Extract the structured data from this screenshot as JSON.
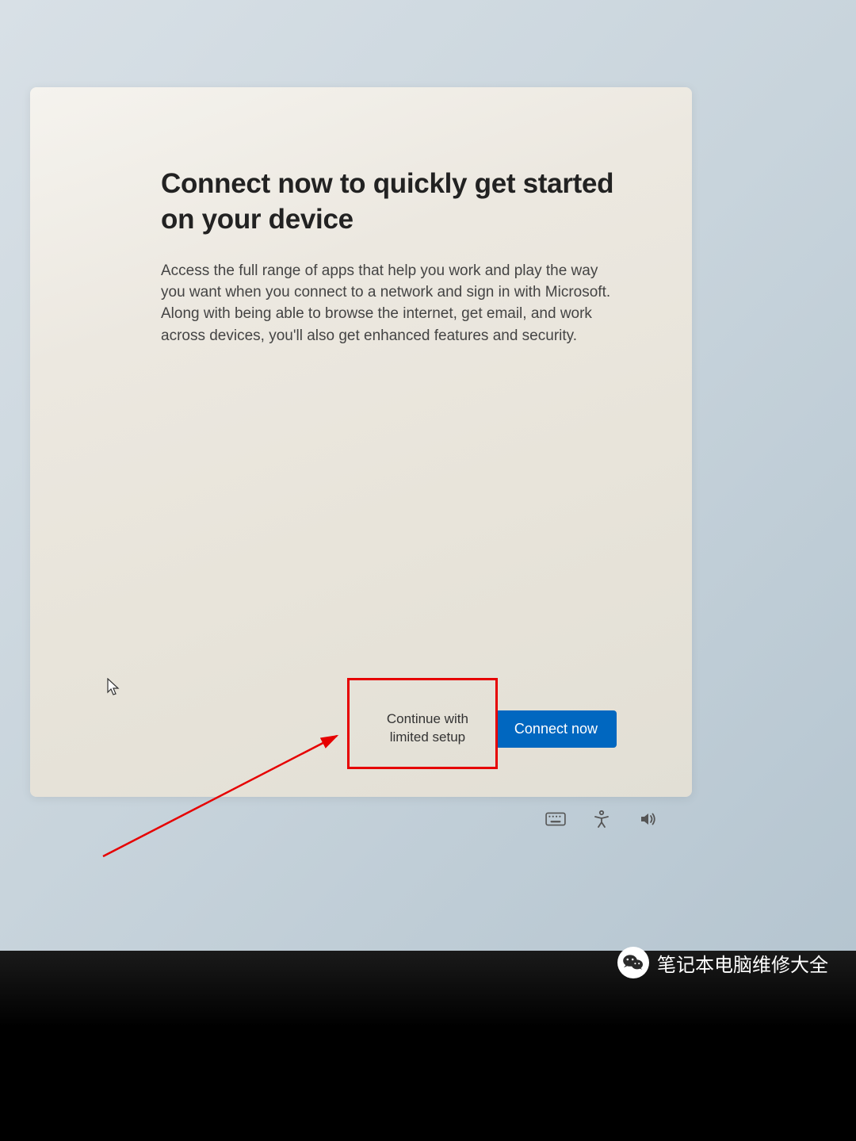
{
  "dialog": {
    "title": "Connect now to quickly get started on your device",
    "body": "Access the full range of apps that help you work and play the way you want when you connect to a network and sign in with Microsoft. Along with being able to browse the internet, get email, and work across devices, you'll also get enhanced features and security.",
    "secondary_button": "Continue with\nlimited setup",
    "primary_button": "Connect now"
  },
  "icons": {
    "keyboard": "keyboard",
    "accessibility": "accessibility",
    "volume": "volume"
  },
  "watermark": {
    "text": "笔记本电脑维修大全"
  },
  "annotation": {
    "highlight_color": "#e60000",
    "arrow_color": "#e60000"
  }
}
